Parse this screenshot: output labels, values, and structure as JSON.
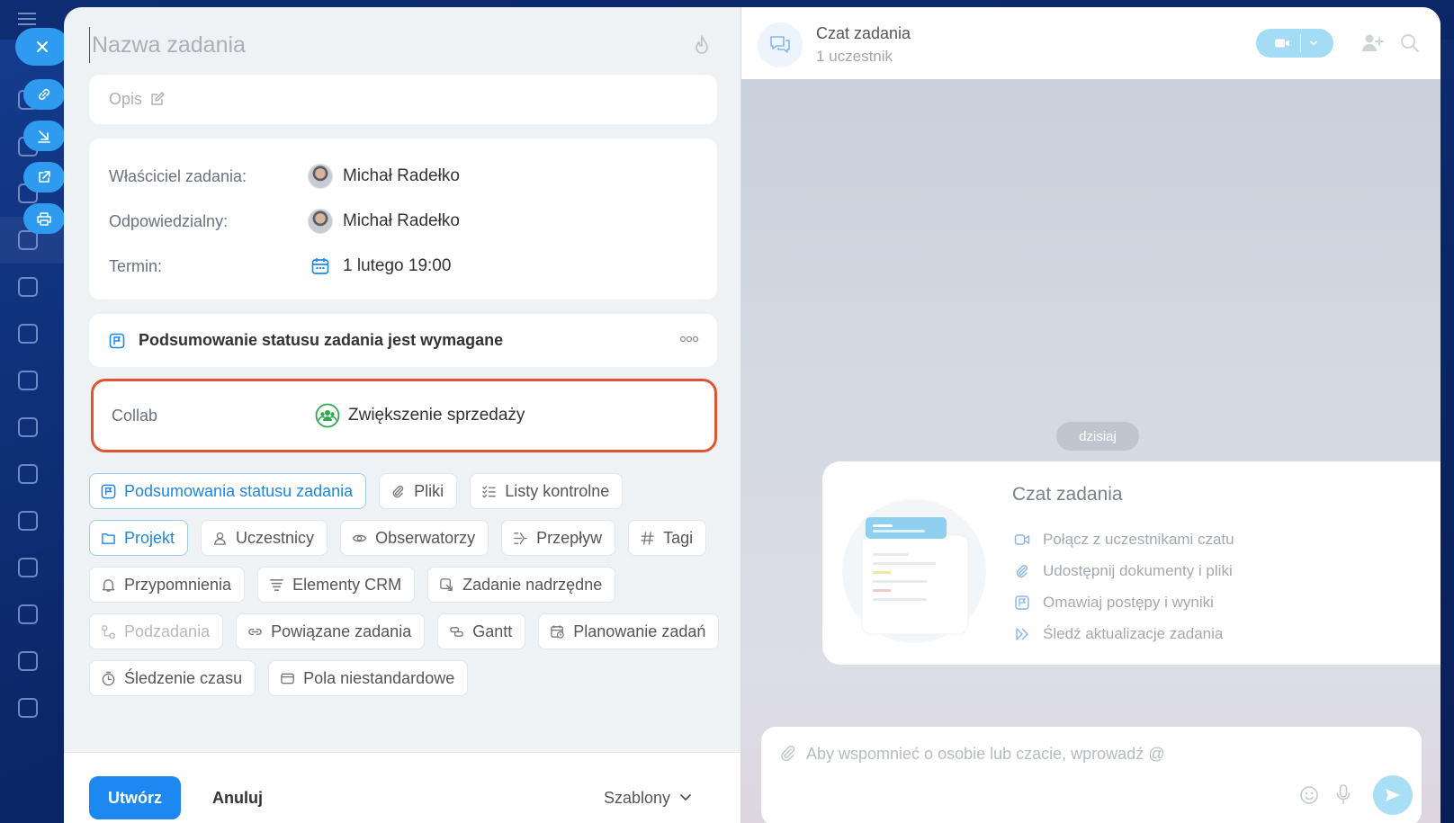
{
  "task": {
    "title_placeholder": "Nazwa zadania",
    "description_placeholder": "Opis",
    "owner_label": "Właściciel zadania:",
    "owner_name": "Michał Radełko",
    "responsible_label": "Odpowiedzialny:",
    "responsible_name": "Michał Radełko",
    "deadline_label": "Termin:",
    "deadline_value": "1 lutego 19:00",
    "status_summary_text": "Podsumowanie statusu zadania jest wymagane",
    "collab_label": "Collab",
    "collab_value": "Zwiększenie sprzedaży"
  },
  "chips": {
    "status_summaries": "Podsumowania statusu zadania",
    "files": "Pliki",
    "checklists": "Listy kontrolne",
    "project": "Projekt",
    "participants": "Uczestnicy",
    "observers": "Obserwatorzy",
    "flow": "Przepływ",
    "tags": "Tagi",
    "reminders": "Przypomnienia",
    "crm_elements": "Elementy CRM",
    "parent_task": "Zadanie nadrzędne",
    "subtasks": "Podzadania",
    "related_tasks": "Powiązane zadania",
    "gantt": "Gantt",
    "task_planning": "Planowanie zadań",
    "time_tracking": "Śledzenie czasu",
    "custom_fields": "Pola niestandardowe"
  },
  "footer": {
    "create_label": "Utwórz",
    "cancel_label": "Anuluj",
    "templates_label": "Szablony"
  },
  "chat": {
    "title": "Czat zadania",
    "subtitle": "1 uczestnik",
    "date_divider": "dzisiaj",
    "welcome_title": "Czat zadania",
    "welcome_items": [
      "Połącz z uczestnikami czatu",
      "Udostępnij dokumenty i pliki",
      "Omawiaj postępy i wyniki",
      "Śledź aktualizacje zadania"
    ],
    "composer_placeholder": "Aby wspomnieć o osobie lub czacie, wprowadź @"
  },
  "colors": {
    "accent": "#1d88f1",
    "highlight_border": "#e2532f",
    "collab_green": "#2fa84f",
    "video_button": "#a5dcf5"
  }
}
